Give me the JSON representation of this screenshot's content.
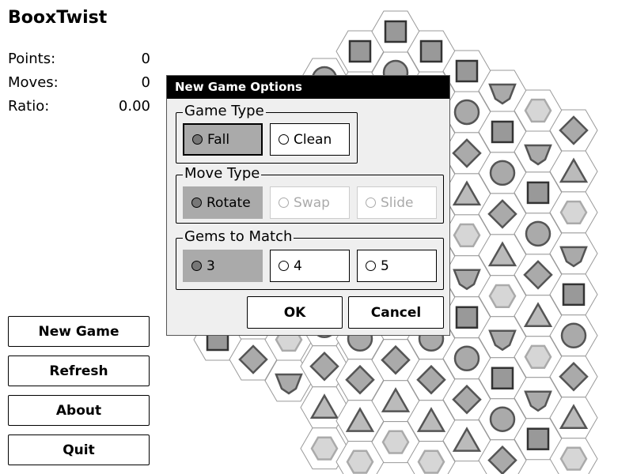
{
  "app": {
    "title": "BooxTwist"
  },
  "stats": [
    {
      "label": "Points:",
      "value": "0"
    },
    {
      "label": "Moves:",
      "value": "0"
    },
    {
      "label": "Ratio:",
      "value": "0.00"
    }
  ],
  "sidebar": {
    "new_game": "New Game",
    "refresh": "Refresh",
    "about": "About",
    "quit": "Quit"
  },
  "dialog": {
    "title": "New Game Options",
    "game_type": {
      "label": "Game Type",
      "options": [
        "Fall",
        "Clean"
      ],
      "selected": "Fall"
    },
    "move_type": {
      "label": "Move Type",
      "options": [
        "Rotate",
        "Swap",
        "Slide"
      ],
      "selected": "Rotate",
      "disabled": [
        "Swap",
        "Slide"
      ]
    },
    "gems_to_match": {
      "label": "Gems to Match",
      "options": [
        "3",
        "4",
        "5"
      ],
      "selected": "3"
    },
    "ok_label": "OK",
    "cancel_label": "Cancel"
  },
  "board": {
    "gem_shapes": [
      "square",
      "circle",
      "diamond",
      "triangle",
      "hexagon",
      "pentagon"
    ],
    "colors": {
      "gem_mid": "#aaaaaa",
      "gem_light": "#d6d6d6",
      "outline": "#555555",
      "hex_border": "#999999"
    }
  }
}
